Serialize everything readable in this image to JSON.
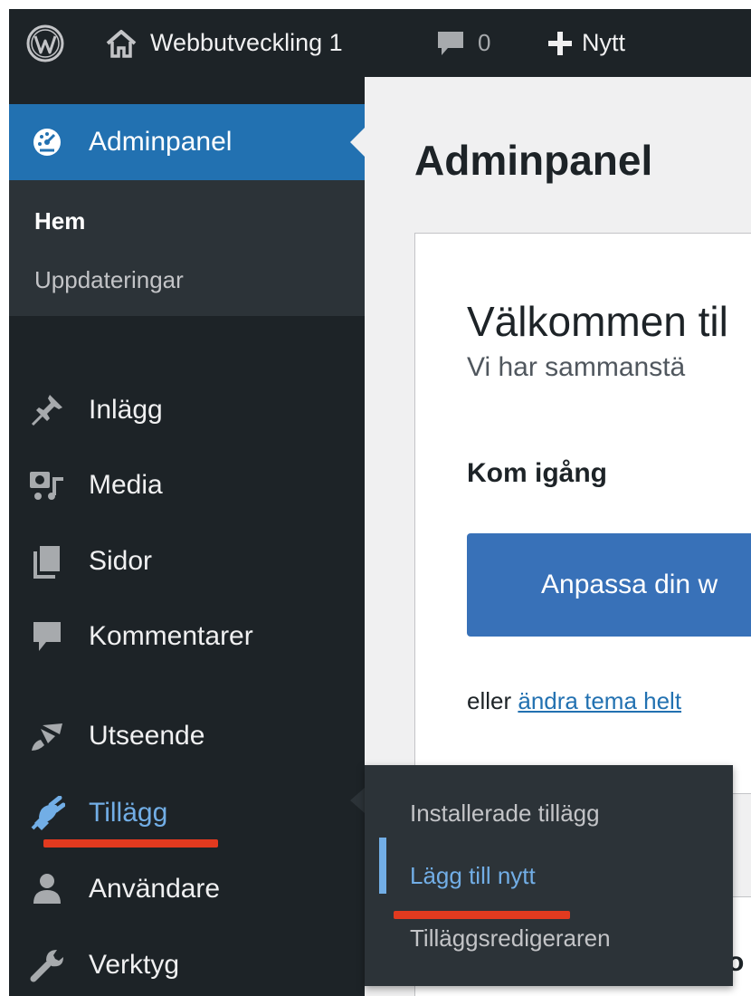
{
  "adminbar": {
    "site_name": "Webbutveckling 1",
    "comment_count": "0",
    "new_label": "Nytt"
  },
  "sidebar": {
    "dashboard_label": "Adminpanel",
    "submenu": [
      "Hem",
      "Uppdateringar"
    ],
    "items": [
      {
        "label": "Inlägg",
        "icon": "pin-icon"
      },
      {
        "label": "Media",
        "icon": "media-icon"
      },
      {
        "label": "Sidor",
        "icon": "pages-icon"
      },
      {
        "label": "Kommentarer",
        "icon": "comment-icon"
      },
      {
        "label": "Utseende",
        "icon": "brush-icon"
      },
      {
        "label": "Tillägg",
        "icon": "plugin-icon"
      },
      {
        "label": "Användare",
        "icon": "user-icon"
      },
      {
        "label": "Verktyg",
        "icon": "wrench-icon"
      }
    ]
  },
  "flyout": {
    "items": [
      "Installerade tillägg",
      "Lägg till nytt",
      "Tilläggsredigeraren"
    ]
  },
  "main": {
    "page_title": "Adminpanel",
    "welcome_title": "Välkommen til",
    "welcome_subtitle": "Vi har sammanstä",
    "get_started": "Kom igång",
    "customize_button": "Anpassa din w",
    "or_text": "eller",
    "change_theme_link": "ändra tema helt",
    "panel2_text": "o"
  },
  "colors": {
    "adminbar_bg": "#1d2327",
    "menu_active_bg": "#2271b1",
    "submenu_bg": "#2c3338",
    "menu_highlight": "#72aee6",
    "annotation_red": "#e23a1f",
    "button_blue": "#3871b8"
  }
}
